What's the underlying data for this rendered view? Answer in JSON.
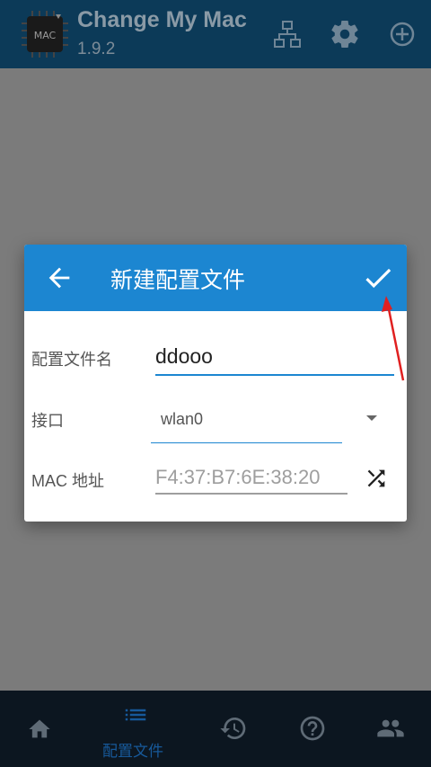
{
  "app": {
    "title": "Change My Mac",
    "version": "1.9.2",
    "logo_text": "MAC"
  },
  "toolbar": {
    "icons": [
      "network-icon",
      "gear-icon",
      "add-circle-icon"
    ]
  },
  "dialog": {
    "title": "新建配置文件",
    "fields": {
      "name_label": "配置文件名",
      "name_value": "ddooo",
      "interface_label": "接口",
      "interface_value": "wlan0",
      "mac_label": "MAC 地址",
      "mac_placeholder": "F4:37:B7:6E:38:20"
    }
  },
  "bottom_nav": {
    "items": [
      {
        "icon": "home-icon",
        "label": ""
      },
      {
        "icon": "list-icon",
        "label": "配置文件"
      },
      {
        "icon": "history-icon",
        "label": ""
      },
      {
        "icon": "help-icon",
        "label": ""
      },
      {
        "icon": "people-icon",
        "label": ""
      }
    ]
  },
  "colors": {
    "dialog_header": "#1c86d1",
    "appbar": "#0c3a58",
    "accent_active_nav": "#17599a",
    "annotation_arrow": "#e02020"
  }
}
